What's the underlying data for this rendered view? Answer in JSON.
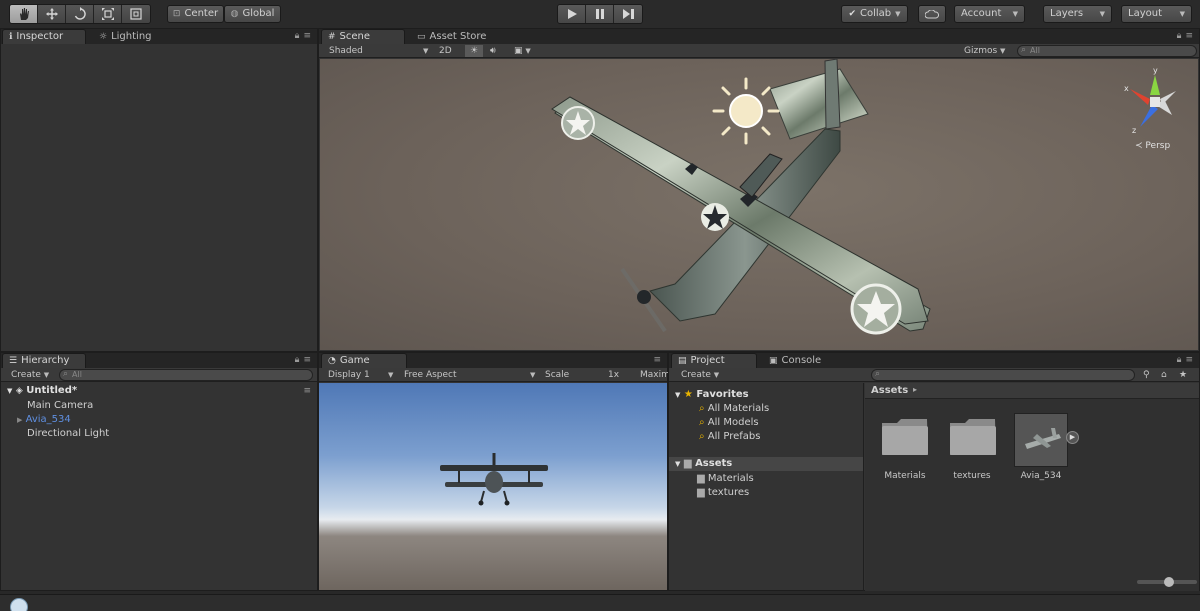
{
  "toolbar": {
    "pivot_label": "Center",
    "space_label": "Global",
    "collab_label": "Collab",
    "account_label": "Account",
    "layers_label": "Layers",
    "layout_label": "Layout"
  },
  "inspector_panel": {
    "tabs": [
      {
        "label": "Inspector"
      },
      {
        "label": "Lighting"
      }
    ]
  },
  "scene_panel": {
    "tabs": [
      {
        "label": "Scene"
      },
      {
        "label": "Asset Store"
      }
    ],
    "shading_mode": "Shaded",
    "mode_2d": "2D",
    "gizmos_label": "Gizmos",
    "search_placeholder": "All",
    "projection_label": "Persp",
    "axis_labels": {
      "x": "x",
      "y": "y",
      "z": "z"
    }
  },
  "hierarchy_panel": {
    "tab_label": "Hierarchy",
    "create_label": "Create",
    "search_placeholder": "All",
    "scene_name": "Untitled*",
    "items": [
      {
        "label": "Main Camera"
      },
      {
        "label": "Avia_534"
      },
      {
        "label": "Directional Light"
      }
    ]
  },
  "game_panel": {
    "tab_label": "Game",
    "display_label": "Display 1",
    "aspect_label": "Free Aspect",
    "scale_label": "Scale",
    "scale_value": "1x",
    "maximize_label": "Maxim"
  },
  "project_panel": {
    "tabs": [
      {
        "label": "Project"
      },
      {
        "label": "Console"
      }
    ],
    "create_label": "Create",
    "favorites_label": "Favorites",
    "favorites": [
      {
        "label": "All Materials"
      },
      {
        "label": "All Models"
      },
      {
        "label": "All Prefabs"
      }
    ],
    "assets_label": "Assets",
    "asset_folders": [
      {
        "label": "Materials"
      },
      {
        "label": "textures"
      }
    ],
    "breadcrumb": "Assets",
    "grid_items": [
      {
        "label": "Materials"
      },
      {
        "label": "textures"
      },
      {
        "label": "Avia_534"
      }
    ]
  },
  "colors": {
    "accent_blue": "#5f8fe0",
    "favorite_star": "#e8b400",
    "sun_gizmo": "#f4e9c8"
  }
}
